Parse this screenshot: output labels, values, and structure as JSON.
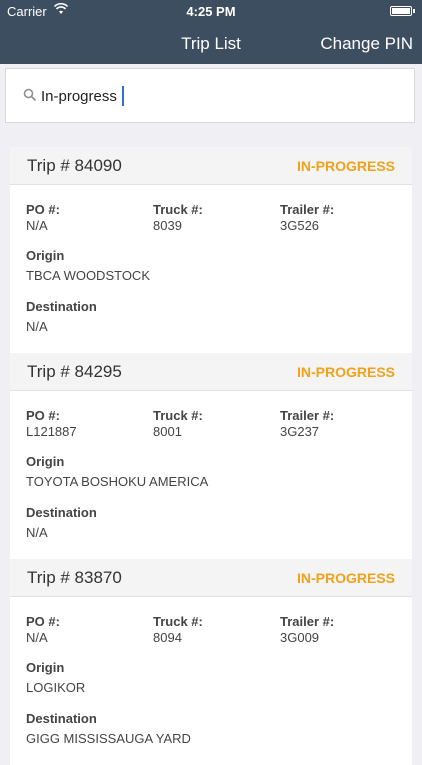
{
  "status_bar": {
    "carrier": "Carrier",
    "time": "4:25 PM"
  },
  "nav": {
    "title": "Trip List",
    "right_button": "Change PIN"
  },
  "search": {
    "value": "In-progress",
    "placeholder": ""
  },
  "labels": {
    "po": "PO #:",
    "truck": "Truck #:",
    "trailer": "Trailer #:",
    "origin": "Origin",
    "destination": "Destination"
  },
  "trips": [
    {
      "trip": "Trip # 84090",
      "status": "IN-PROGRESS",
      "po": "N/A",
      "truck": "8039",
      "trailer": "3G526",
      "origin": "TBCA WOODSTOCK",
      "destination": "N/A"
    },
    {
      "trip": "Trip # 84295",
      "status": "IN-PROGRESS",
      "po": "L121887",
      "truck": "8001",
      "trailer": "3G237",
      "origin": "TOYOTA BOSHOKU AMERICA",
      "destination": "N/A"
    },
    {
      "trip": "Trip # 83870",
      "status": "IN-PROGRESS",
      "po": "N/A",
      "truck": "8094",
      "trailer": "3G009",
      "origin": "LOGIKOR",
      "destination": "GIGG MISSISSAUGA YARD"
    }
  ],
  "colors": {
    "nav_bg": "#3d4e60",
    "status_accent": "#f0a21b"
  }
}
